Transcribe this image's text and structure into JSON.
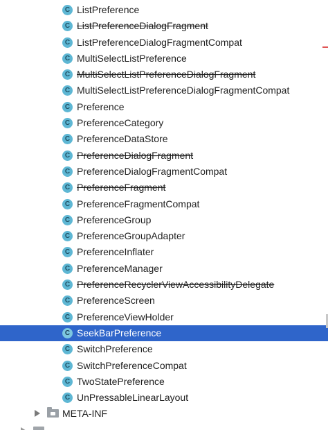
{
  "tree": {
    "items": [
      {
        "label": "ListPreference",
        "deprecated": false
      },
      {
        "label": "ListPreferenceDialogFragment",
        "deprecated": true
      },
      {
        "label": "ListPreferenceDialogFragmentCompat",
        "deprecated": false
      },
      {
        "label": "MultiSelectListPreference",
        "deprecated": false
      },
      {
        "label": "MultiSelectListPreferenceDialogFragment",
        "deprecated": true
      },
      {
        "label": "MultiSelectListPreferenceDialogFragmentCompat",
        "deprecated": false
      },
      {
        "label": "Preference",
        "deprecated": false
      },
      {
        "label": "PreferenceCategory",
        "deprecated": false
      },
      {
        "label": "PreferenceDataStore",
        "deprecated": false
      },
      {
        "label": "PreferenceDialogFragment",
        "deprecated": true
      },
      {
        "label": "PreferenceDialogFragmentCompat",
        "deprecated": false
      },
      {
        "label": "PreferenceFragment",
        "deprecated": true
      },
      {
        "label": "PreferenceFragmentCompat",
        "deprecated": false
      },
      {
        "label": "PreferenceGroup",
        "deprecated": false
      },
      {
        "label": "PreferenceGroupAdapter",
        "deprecated": false
      },
      {
        "label": "PreferenceInflater",
        "deprecated": false
      },
      {
        "label": "PreferenceManager",
        "deprecated": false
      },
      {
        "label": "PreferenceRecyclerViewAccessibilityDelegate",
        "deprecated": true
      },
      {
        "label": "PreferenceScreen",
        "deprecated": false
      },
      {
        "label": "PreferenceViewHolder",
        "deprecated": false
      },
      {
        "label": "SeekBarPreference",
        "deprecated": false,
        "selected": true
      },
      {
        "label": "SwitchPreference",
        "deprecated": false
      },
      {
        "label": "SwitchPreferenceCompat",
        "deprecated": false
      },
      {
        "label": "TwoStatePreference",
        "deprecated": false
      },
      {
        "label": "UnPressableLinearLayout",
        "deprecated": false
      }
    ],
    "class_icon_glyph": "C",
    "class_icon_name": "class-icon",
    "folder": {
      "label": "META-INF",
      "icon_name": "folder-icon",
      "expander_icon_name": "chevron-right-icon"
    }
  },
  "colors": {
    "selection": "#2f65ca",
    "class_icon": "#5eb7d4",
    "text": "#1e1e1e"
  }
}
